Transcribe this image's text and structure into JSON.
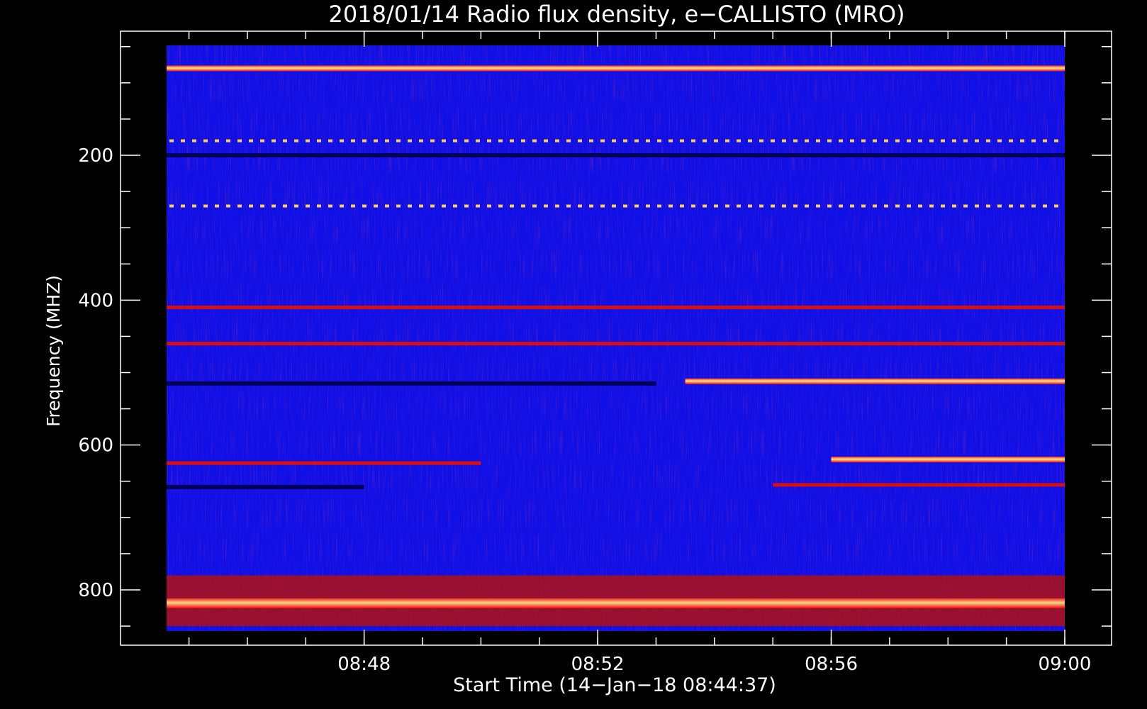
{
  "chart_data": {
    "type": "heatmap",
    "title": "2018/01/14  Radio flux density, e−CALLISTO (MRO)",
    "xlabel": "Start Time (14−Jan−18 08:44:37)",
    "ylabel": "Frequency (MHZ)",
    "x_range": [
      "08:44:37",
      "09:00:00"
    ],
    "x_ticks": [
      "08:48",
      "08:52",
      "08:56",
      "09:00"
    ],
    "y_range_mhz": [
      45,
      870
    ],
    "y_axis_inverted": true,
    "y_ticks": [
      200,
      400,
      600,
      800
    ],
    "colormap": [
      "#000000",
      "#1010e6",
      "#cc0000",
      "#ff8000",
      "#ffff80"
    ],
    "background_color": "#1010e6",
    "features": [
      {
        "freq_mhz": 80,
        "start": "08:44:37",
        "end": "09:00:00",
        "intensity": "high",
        "note": "strong band, brightest at start and end"
      },
      {
        "freq_mhz": 180,
        "start": "08:44:37",
        "end": "09:00:00",
        "intensity": "dotted"
      },
      {
        "freq_mhz": 200,
        "start": "08:44:37",
        "end": "09:00:00",
        "intensity": "low"
      },
      {
        "freq_mhz": 270,
        "start": "08:44:37",
        "end": "09:00:00",
        "intensity": "dotted"
      },
      {
        "freq_mhz": 410,
        "start": "08:44:37",
        "end": "09:00:00",
        "intensity": "medium"
      },
      {
        "freq_mhz": 460,
        "start": "08:44:37",
        "end": "09:00:00",
        "intensity": "medium"
      },
      {
        "freq_mhz": 515,
        "start": "08:44:37",
        "end": "08:53:00",
        "intensity": "low"
      },
      {
        "freq_mhz": 512,
        "start": "08:53:30",
        "end": "09:00:00",
        "intensity": "high"
      },
      {
        "freq_mhz": 625,
        "start": "08:44:37",
        "end": "08:50:00",
        "intensity": "medium"
      },
      {
        "freq_mhz": 620,
        "start": "08:56:00",
        "end": "09:00:00",
        "intensity": "high"
      },
      {
        "freq_mhz": 658,
        "start": "08:44:37",
        "end": "08:48:00",
        "intensity": "low"
      },
      {
        "freq_mhz": 655,
        "start": "08:55:00",
        "end": "09:00:00",
        "intensity": "medium"
      },
      {
        "freq_mhz": 815,
        "start": "08:44:37",
        "end": "09:00:00",
        "intensity": "high",
        "note": "broadband interference band 780−850 MHz"
      }
    ]
  }
}
